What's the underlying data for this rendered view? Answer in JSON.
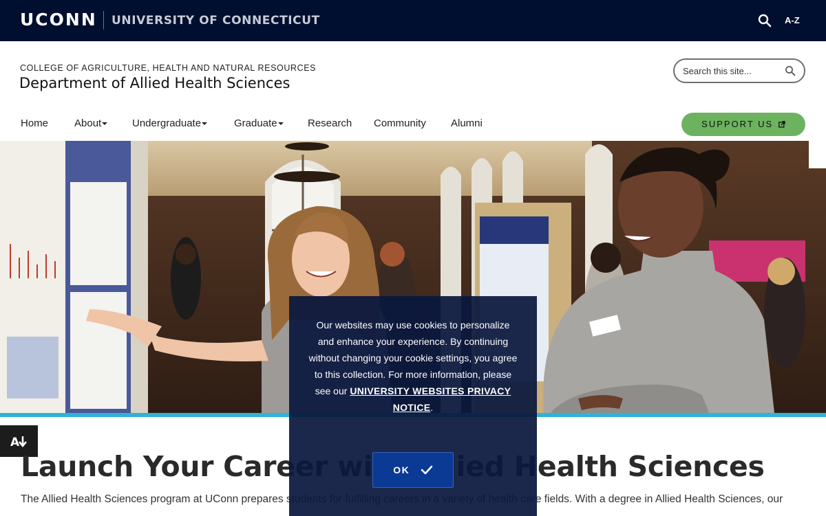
{
  "university_bar": {
    "logo": "UCONN",
    "name": "UNIVERSITY OF CONNECTICUT",
    "search_icon": "search-icon",
    "az_label": "A-Z"
  },
  "header": {
    "college": "COLLEGE OF AGRICULTURE, HEALTH AND NATURAL RESOURCES",
    "department": "Department of Allied Health Sciences",
    "search_placeholder": "Search this site..."
  },
  "nav": {
    "items": [
      {
        "label": "Home",
        "has_dropdown": false
      },
      {
        "label": "About",
        "has_dropdown": true
      },
      {
        "label": "Undergraduate",
        "has_dropdown": true
      },
      {
        "label": "Graduate",
        "has_dropdown": true
      },
      {
        "label": "Research",
        "has_dropdown": false
      },
      {
        "label": "Community",
        "has_dropdown": false
      },
      {
        "label": "Alumni",
        "has_dropdown": false
      }
    ],
    "support_label": "SUPPORT US",
    "support_icon": "external-link-icon"
  },
  "hero": {
    "image": "Students presenting research posters in a hall"
  },
  "main": {
    "headline": "Launch Your Career with Allied Health Sciences",
    "intro": "The Allied Health Sciences program at UConn prepares students for fulfilling careers in a variety of health care fields. With a degree in Allied Health Sciences, our"
  },
  "cookie": {
    "message": "Our websites may use cookies to personalize and enhance your experience. By continuing without changing your cookie settings, you agree to this collection. For more information, please see our",
    "link": "UNIVERSITY WEBSITES PRIVACY NOTICE",
    "after_link": ".",
    "ok_label": "OK"
  },
  "accessibility": {
    "icon": "accessibility-download-icon"
  },
  "colors": {
    "top_bar": "#000e2f",
    "support_button": "#6db35f",
    "accent_line": "#2fb3d8",
    "ok_button": "#0b3a95",
    "cookie_overlay": "#0a183d"
  }
}
